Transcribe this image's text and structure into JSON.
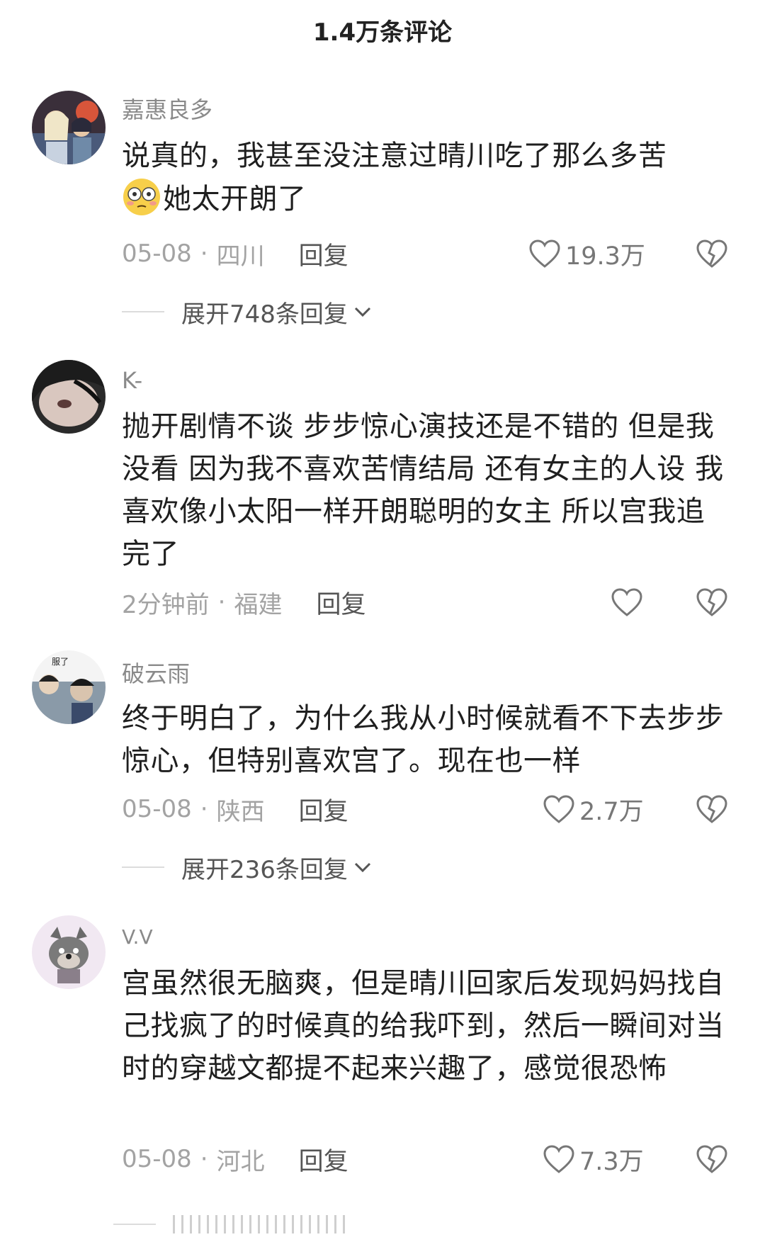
{
  "header": {
    "title": "1.4万条评论"
  },
  "comments": [
    {
      "username": "嘉惠良多",
      "avatar_icon": "anime-characters-avatar",
      "emoji": "flushed-face-emoji",
      "text": "说真的，我甚至没注意过晴川吃了那么多苦",
      "text2": "她太开朗了",
      "date": "05-08",
      "location": "四川",
      "reply_label": "回复",
      "likes": "19.3万",
      "expand_label": "展开748条回复"
    },
    {
      "username": "K-",
      "avatar_icon": "photo-avatar",
      "text": "抛开剧情不谈 步步惊心演技还是不错的 但是我没看 因为我不喜欢苦情结局 还有女主的人设 我喜欢像小太阳一样开朗聪明的女主 所以宫我追完了",
      "date": "2分钟前",
      "location": "福建",
      "reply_label": "回复",
      "likes": ""
    },
    {
      "username": "破云雨",
      "avatar_icon": "meme-avatar",
      "avatar_text": "服了",
      "text": "终于明白了，为什么我从小时候就看不下去步步惊心，但特别喜欢宫了。现在也一样",
      "date": "05-08",
      "location": "陕西",
      "reply_label": "回复",
      "likes": "2.7万",
      "expand_label": "展开236条回复"
    },
    {
      "username": "V.V",
      "avatar_icon": "grey-wolf-cartoon-avatar",
      "text": "宫虽然很无脑爽，但是晴川回家后发现妈妈找自己找疯了的时候真的给我吓到，然后一瞬间对当时的穿越文都提不起来兴趣了，感觉很恐怖",
      "date": "05-08",
      "location": "河北",
      "reply_label": "回复",
      "likes": "7.3万"
    }
  ],
  "separator": "·",
  "colors": {
    "meta": "#a3a3a3",
    "text": "#1f1f1f",
    "username": "#8a8a8a"
  }
}
